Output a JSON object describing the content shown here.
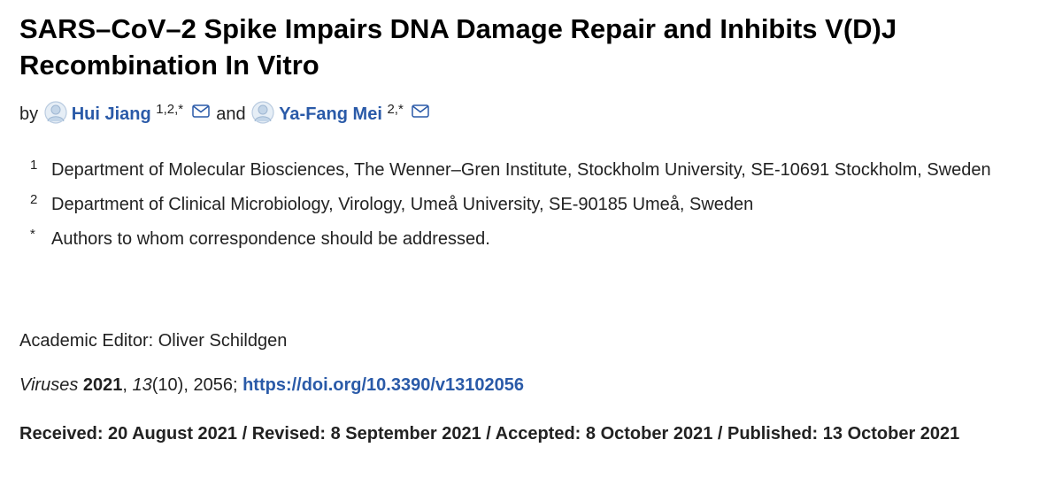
{
  "article": {
    "title": "SARS–CoV–2 Spike Impairs DNA Damage Repair and Inhibits V(D)J Recombination In Vitro"
  },
  "authors": {
    "by_label": "by",
    "joiner": "and",
    "list": [
      {
        "name": "Hui Jiang",
        "affil": "1,2,*"
      },
      {
        "name": "Ya-Fang Mei",
        "affil": "2,*"
      }
    ]
  },
  "affiliations": [
    {
      "marker": "1",
      "text": "Department of Molecular Biosciences, The Wenner–Gren Institute, Stockholm University, SE-10691 Stockholm, Sweden"
    },
    {
      "marker": "2",
      "text": "Department of Clinical Microbiology, Virology, Umeå University, SE-90185 Umeå, Sweden"
    },
    {
      "marker": "*",
      "text": "Authors to whom correspondence should be addressed."
    }
  ],
  "editor": {
    "text": "Academic Editor: Oliver Schildgen"
  },
  "citation": {
    "journal": "Viruses",
    "year": "2021",
    "sep1": ", ",
    "volume": "13",
    "issue_pages": "(10), 2056; ",
    "doi_text": "https://doi.org/10.3390/v13102056"
  },
  "dates": {
    "text": "Received: 20 August 2021 / Revised: 8 September 2021 / Accepted: 8 October 2021 / Published: 13 October 2021"
  },
  "colors": {
    "link": "#2a5aa8",
    "text": "#222222",
    "title": "#000000"
  },
  "icons": [
    "author-avatar-icon",
    "mail-icon"
  ]
}
